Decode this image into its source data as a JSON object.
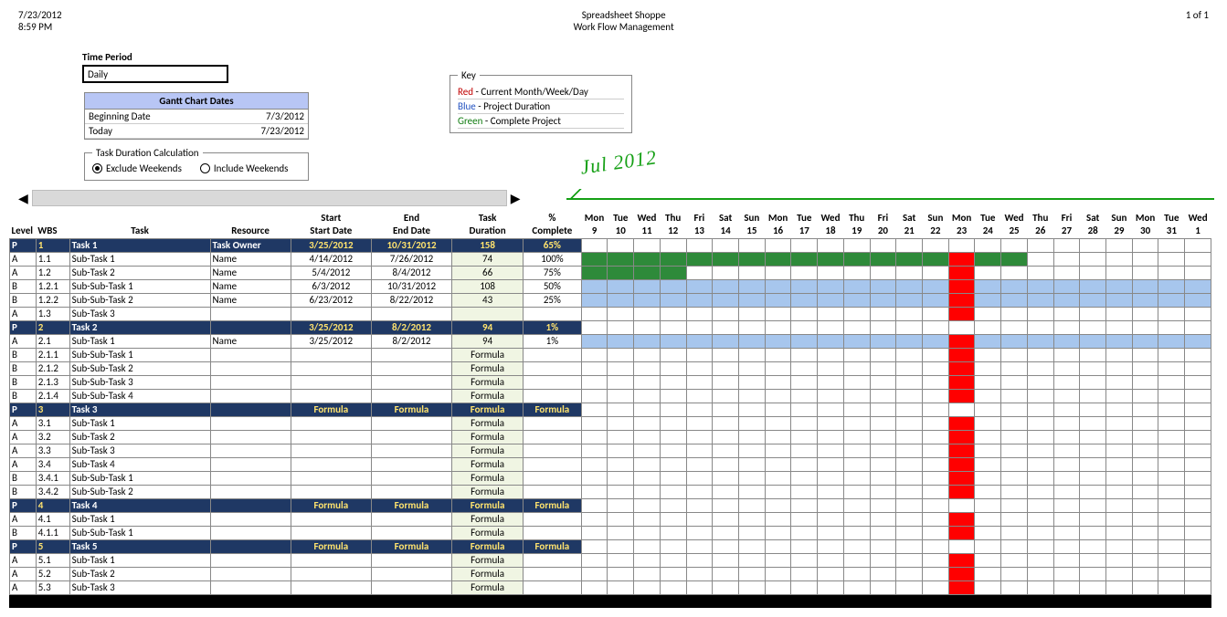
{
  "header": {
    "date": "7/23/2012",
    "time": "8:59 PM",
    "company": "Spreadsheet Shoppe",
    "doc": "Work Flow Management",
    "page": "1 of 1"
  },
  "config": {
    "time_period_label": "Time Period",
    "time_period_value": "Daily",
    "gantt_title": "Gantt Chart Dates",
    "beg_label": "Beginning Date",
    "beg_val": "7/3/2012",
    "today_label": "Today",
    "today_val": "7/23/2012",
    "tdc_legend": "Task Duration Calculation",
    "opt_excl": "Exclude Weekends",
    "opt_incl": "Include Weekends",
    "tdc_selected": "exclude"
  },
  "key": {
    "legend": "Key",
    "l1a": "Red",
    "l1b": " - Current Month/Week/Day",
    "l2a": "Blue",
    "l2b": " - Project Duration",
    "l3a": "Green",
    "l3b": " - Complete Project"
  },
  "month": "Jul 2012",
  "columns": {
    "level": "Level",
    "wbs": "WBS",
    "task": "Task",
    "res": "Resource",
    "start1": "Start",
    "start2": "Start Date",
    "end1": "End",
    "end2": "End Date",
    "dur1": "Task",
    "dur2": "Duration",
    "comp1": "%",
    "comp2": "Complete"
  },
  "days": [
    {
      "dow": "Mon",
      "num": "9"
    },
    {
      "dow": "Tue",
      "num": "10"
    },
    {
      "dow": "Wed",
      "num": "11"
    },
    {
      "dow": "Thu",
      "num": "12"
    },
    {
      "dow": "Fri",
      "num": "13"
    },
    {
      "dow": "Sat",
      "num": "14"
    },
    {
      "dow": "Sun",
      "num": "15"
    },
    {
      "dow": "Mon",
      "num": "16"
    },
    {
      "dow": "Tue",
      "num": "17"
    },
    {
      "dow": "Wed",
      "num": "18"
    },
    {
      "dow": "Thu",
      "num": "19"
    },
    {
      "dow": "Fri",
      "num": "20"
    },
    {
      "dow": "Sat",
      "num": "21"
    },
    {
      "dow": "Sun",
      "num": "22"
    },
    {
      "dow": "Mon",
      "num": "23"
    },
    {
      "dow": "Tue",
      "num": "24"
    },
    {
      "dow": "Wed",
      "num": "25"
    },
    {
      "dow": "Thu",
      "num": "26"
    },
    {
      "dow": "Fri",
      "num": "27"
    },
    {
      "dow": "Sat",
      "num": "28"
    },
    {
      "dow": "Sun",
      "num": "29"
    },
    {
      "dow": "Mon",
      "num": "30"
    },
    {
      "dow": "Tue",
      "num": "31"
    },
    {
      "dow": "Wed",
      "num": "1"
    }
  ],
  "today_col": 14,
  "rows": [
    {
      "type": "P",
      "level": "P",
      "wbs": "1",
      "task": "Task 1",
      "res": "Task Owner",
      "sd": "3/25/2012",
      "ed": "10/31/2012",
      "dur": "158",
      "comp": "65%",
      "bar": {
        "from": 0,
        "to": 24,
        "color": "green",
        "blank": [
          17
        ]
      }
    },
    {
      "type": "A",
      "level": "A",
      "wbs": "1.1",
      "task": "Sub-Task 1",
      "indent": 1,
      "res": "Name",
      "sd": "4/14/2012",
      "ed": "7/26/2012",
      "dur": "74",
      "comp": "100%",
      "bar": {
        "from": 0,
        "to": 17,
        "color": "green"
      }
    },
    {
      "type": "A",
      "level": "A",
      "wbs": "1.2",
      "task": "Sub-Task 2",
      "indent": 1,
      "res": "Name",
      "sd": "5/4/2012",
      "ed": "8/4/2012",
      "dur": "66",
      "comp": "75%",
      "bar": {
        "from": 0,
        "to": 4,
        "color": "green"
      }
    },
    {
      "type": "B",
      "level": "B",
      "wbs": "1.2.1",
      "task": "Sub-Sub-Task 1",
      "indent": 2,
      "res": "Name",
      "sd": "6/3/2012",
      "ed": "10/31/2012",
      "dur": "108",
      "comp": "50%",
      "bar": {
        "from": 0,
        "to": 24,
        "color": "blue"
      }
    },
    {
      "type": "B",
      "level": "B",
      "wbs": "1.2.2",
      "task": "Sub-Sub-Task 2",
      "indent": 2,
      "res": "Name",
      "sd": "6/23/2012",
      "ed": "8/22/2012",
      "dur": "43",
      "comp": "25%",
      "bar": {
        "from": 0,
        "to": 24,
        "color": "blue"
      }
    },
    {
      "type": "A",
      "level": "A",
      "wbs": "1.3",
      "task": "Sub-Task 3",
      "indent": 1,
      "res": "",
      "sd": "",
      "ed": "",
      "dur": "",
      "comp": ""
    },
    {
      "type": "P",
      "level": "P",
      "wbs": "2",
      "task": "Task 2",
      "res": "",
      "sd": "3/25/2012",
      "ed": "8/2/2012",
      "dur": "94",
      "comp": "1%"
    },
    {
      "type": "A",
      "level": "A",
      "wbs": "2.1",
      "task": "Sub-Task 1",
      "indent": 1,
      "res": "Name",
      "sd": "3/25/2012",
      "ed": "8/2/2012",
      "dur": "94",
      "comp": "1%",
      "bar": {
        "from": 0,
        "to": 24,
        "color": "blue"
      }
    },
    {
      "type": "B",
      "level": "B",
      "wbs": "2.1.1",
      "task": "Sub-Sub-Task 1",
      "indent": 2,
      "res": "",
      "sd": "",
      "ed": "",
      "dur": "Formula",
      "comp": ""
    },
    {
      "type": "B",
      "level": "B",
      "wbs": "2.1.2",
      "task": "Sub-Sub-Task 2",
      "indent": 2,
      "res": "",
      "sd": "",
      "ed": "",
      "dur": "Formula",
      "comp": ""
    },
    {
      "type": "B",
      "level": "B",
      "wbs": "2.1.3",
      "task": "Sub-Sub-Task 3",
      "indent": 2,
      "res": "",
      "sd": "",
      "ed": "",
      "dur": "Formula",
      "comp": ""
    },
    {
      "type": "B",
      "level": "B",
      "wbs": "2.1.4",
      "task": "Sub-Sub-Task 4",
      "indent": 2,
      "res": "",
      "sd": "",
      "ed": "",
      "dur": "Formula",
      "comp": ""
    },
    {
      "type": "P",
      "level": "P",
      "wbs": "3",
      "task": "Task 3",
      "res": "",
      "sd": "Formula",
      "ed": "Formula",
      "dur": "Formula",
      "comp": "Formula"
    },
    {
      "type": "A",
      "level": "A",
      "wbs": "3.1",
      "task": "Sub-Task 1",
      "indent": 1,
      "res": "",
      "sd": "",
      "ed": "",
      "dur": "Formula",
      "comp": ""
    },
    {
      "type": "A",
      "level": "A",
      "wbs": "3.2",
      "task": "Sub-Task 2",
      "indent": 1,
      "res": "",
      "sd": "",
      "ed": "",
      "dur": "Formula",
      "comp": ""
    },
    {
      "type": "A",
      "level": "A",
      "wbs": "3.3",
      "task": "Sub-Task 3",
      "indent": 1,
      "res": "",
      "sd": "",
      "ed": "",
      "dur": "Formula",
      "comp": ""
    },
    {
      "type": "A",
      "level": "A",
      "wbs": "3.4",
      "task": "Sub-Task 4",
      "indent": 1,
      "res": "",
      "sd": "",
      "ed": "",
      "dur": "Formula",
      "comp": ""
    },
    {
      "type": "B",
      "level": "B",
      "wbs": "3.4.1",
      "task": "Sub-Sub-Task 1",
      "indent": 2,
      "res": "",
      "sd": "",
      "ed": "",
      "dur": "Formula",
      "comp": ""
    },
    {
      "type": "B",
      "level": "B",
      "wbs": "3.4.2",
      "task": "Sub-Sub-Task 2",
      "indent": 2,
      "res": "",
      "sd": "",
      "ed": "",
      "dur": "Formula",
      "comp": ""
    },
    {
      "type": "P",
      "level": "P",
      "wbs": "4",
      "task": "Task 4",
      "res": "",
      "sd": "Formula",
      "ed": "Formula",
      "dur": "Formula",
      "comp": "Formula"
    },
    {
      "type": "A",
      "level": "A",
      "wbs": "4.1",
      "task": "Sub-Task 1",
      "indent": 1,
      "res": "",
      "sd": "",
      "ed": "",
      "dur": "Formula",
      "comp": ""
    },
    {
      "type": "B",
      "level": "B",
      "wbs": "4.1.1",
      "task": "Sub-Sub-Task 1",
      "indent": 2,
      "res": "",
      "sd": "",
      "ed": "",
      "dur": "Formula",
      "comp": ""
    },
    {
      "type": "P",
      "level": "P",
      "wbs": "5",
      "task": "Task 5",
      "res": "",
      "sd": "Formula",
      "ed": "Formula",
      "dur": "Formula",
      "comp": "Formula"
    },
    {
      "type": "A",
      "level": "A",
      "wbs": "5.1",
      "task": "Sub-Task 1",
      "indent": 1,
      "res": "",
      "sd": "",
      "ed": "",
      "dur": "Formula",
      "comp": ""
    },
    {
      "type": "A",
      "level": "A",
      "wbs": "5.2",
      "task": "Sub-Task 2",
      "indent": 1,
      "res": "",
      "sd": "",
      "ed": "",
      "dur": "Formula",
      "comp": ""
    },
    {
      "type": "A",
      "level": "A",
      "wbs": "5.3",
      "task": "Sub-Task 3",
      "indent": 1,
      "res": "",
      "sd": "",
      "ed": "",
      "dur": "Formula",
      "comp": ""
    }
  ],
  "chart_data": {
    "type": "gantt",
    "title": "Work Flow Management",
    "view": "Daily",
    "visible_range": {
      "start": "2012-07-09",
      "end": "2012-08-01"
    },
    "today": "2012-07-23",
    "tasks": [
      {
        "wbs": "1",
        "name": "Task 1",
        "start": "2012-03-25",
        "end": "2012-10-31",
        "duration_days": 158,
        "pct_complete": 65
      },
      {
        "wbs": "1.1",
        "name": "Sub-Task 1",
        "start": "2012-04-14",
        "end": "2012-07-26",
        "duration_days": 74,
        "pct_complete": 100
      },
      {
        "wbs": "1.2",
        "name": "Sub-Task 2",
        "start": "2012-05-04",
        "end": "2012-08-04",
        "duration_days": 66,
        "pct_complete": 75
      },
      {
        "wbs": "1.2.1",
        "name": "Sub-Sub-Task 1",
        "start": "2012-06-03",
        "end": "2012-10-31",
        "duration_days": 108,
        "pct_complete": 50
      },
      {
        "wbs": "1.2.2",
        "name": "Sub-Sub-Task 2",
        "start": "2012-06-23",
        "end": "2012-08-22",
        "duration_days": 43,
        "pct_complete": 25
      },
      {
        "wbs": "2",
        "name": "Task 2",
        "start": "2012-03-25",
        "end": "2012-08-02",
        "duration_days": 94,
        "pct_complete": 1
      },
      {
        "wbs": "2.1",
        "name": "Sub-Task 1",
        "start": "2012-03-25",
        "end": "2012-08-02",
        "duration_days": 94,
        "pct_complete": 1
      }
    ]
  }
}
